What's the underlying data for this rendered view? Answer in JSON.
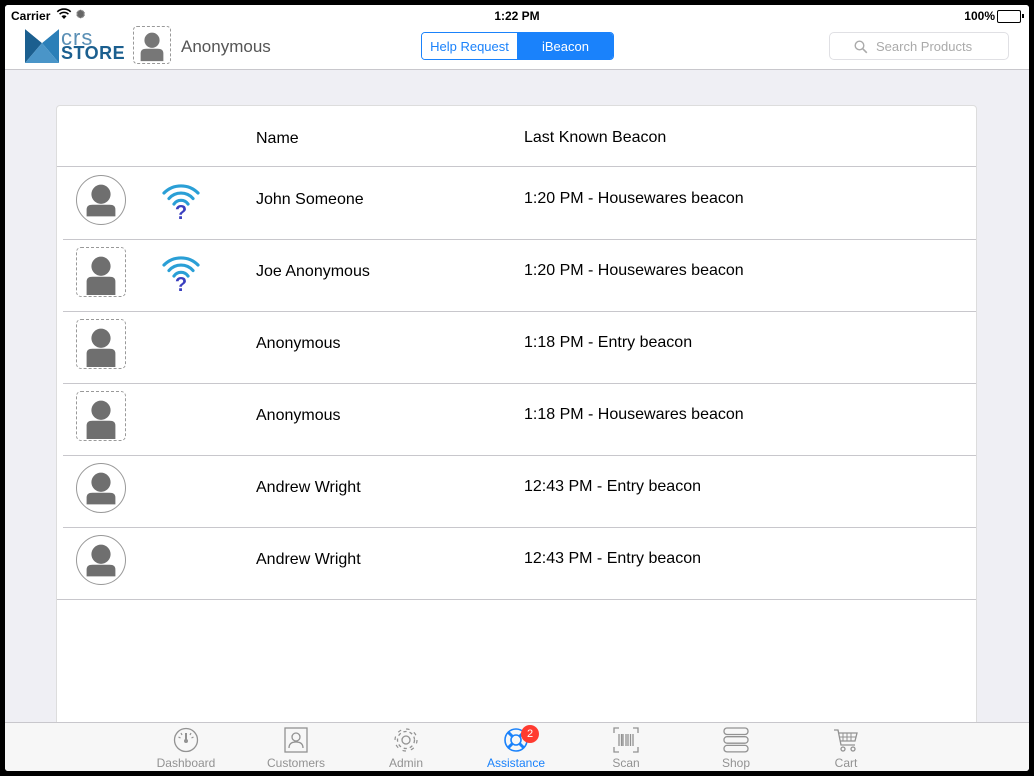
{
  "status_bar": {
    "carrier": "Carrier",
    "time": "1:22 PM",
    "battery": "100%"
  },
  "header": {
    "logo_top": "crs",
    "logo_bottom": "STORE",
    "user_name": "Anonymous",
    "segments": [
      "Help Request",
      "iBeacon"
    ],
    "selected_segment": "iBeacon",
    "search_placeholder": "Search Products"
  },
  "table": {
    "columns": [
      "Name",
      "Last Known Beacon"
    ],
    "rows": [
      {
        "avatar": "round",
        "beacon_icon": "wifi-question-icon",
        "name": "John Someone",
        "last_beacon": "1:20 PM - Housewares beacon"
      },
      {
        "avatar": "dashed",
        "beacon_icon": "wifi-question-icon",
        "name": "Joe Anonymous",
        "last_beacon": "1:20 PM - Housewares beacon"
      },
      {
        "avatar": "dashed",
        "name": "Anonymous",
        "last_beacon": "1:18 PM - Entry beacon"
      },
      {
        "avatar": "dashed",
        "name": "Anonymous",
        "last_beacon": "1:18 PM - Housewares beacon"
      },
      {
        "avatar": "round",
        "name": "Andrew Wright",
        "last_beacon": "12:43 PM - Entry beacon"
      },
      {
        "avatar": "round",
        "name": "Andrew Wright",
        "last_beacon": "12:43 PM - Entry beacon"
      }
    ]
  },
  "tabbar": {
    "tabs": [
      {
        "label": "Dashboard",
        "icon": "gauge-icon"
      },
      {
        "label": "Customers",
        "icon": "contacts-icon"
      },
      {
        "label": "Admin",
        "icon": "gear-icon"
      },
      {
        "label": "Assistance",
        "icon": "lifebuoy-icon",
        "badge": "2",
        "active": true
      },
      {
        "label": "Scan",
        "icon": "barcode-icon"
      },
      {
        "label": "Shop",
        "icon": "stack-icon"
      },
      {
        "label": "Cart",
        "icon": "cart-icon"
      }
    ]
  },
  "colors": {
    "accent": "#1a82fb",
    "badge": "#ff3b30",
    "beacon_wifi": "#2a9fd6",
    "beacon_question": "#3a3fbf"
  }
}
